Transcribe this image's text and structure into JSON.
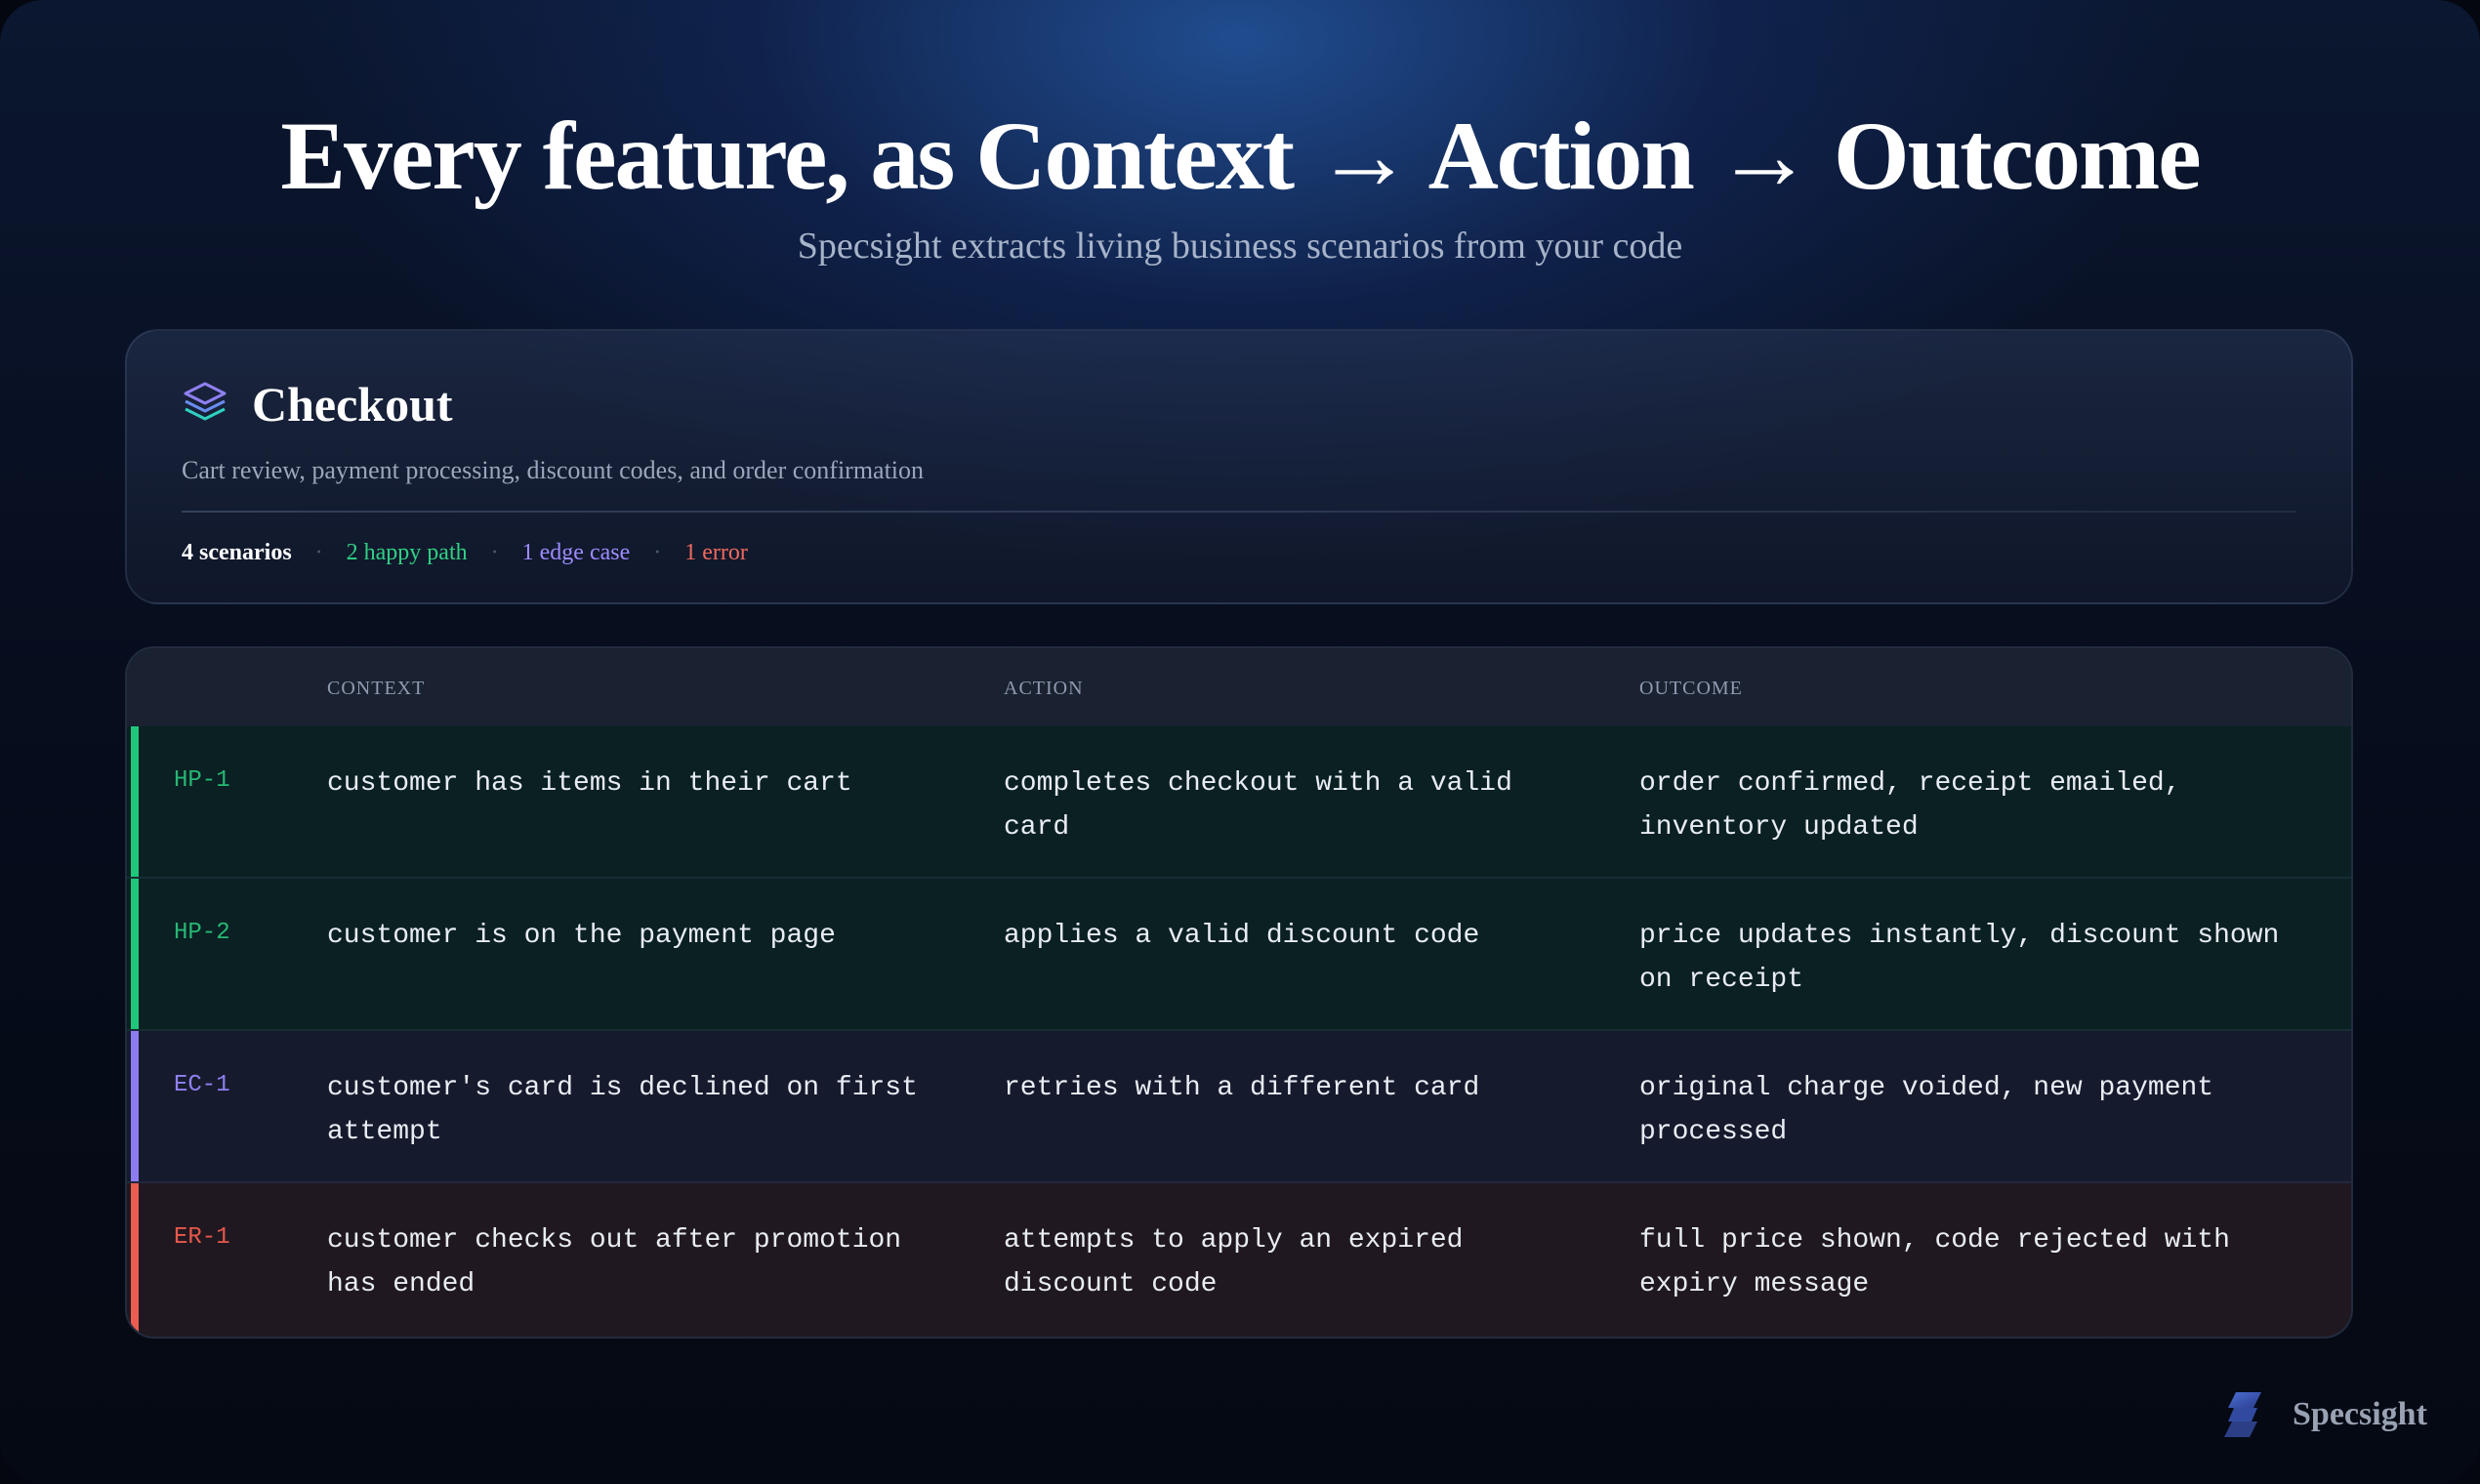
{
  "hero": {
    "title": "Every feature, as Context → Action → Outcome",
    "subtitle": "Specsight extracts living business scenarios from your code"
  },
  "feature": {
    "icon": "layers-icon",
    "title": "Checkout",
    "description": "Cart review, payment processing, discount codes, and order confirmation",
    "stats": {
      "total": "4 scenarios",
      "happy": "2 happy path",
      "edge": "1 edge case",
      "error": "1 error",
      "separator": "·"
    }
  },
  "table": {
    "headers": {
      "context": "CONTEXT",
      "action": "ACTION",
      "outcome": "OUTCOME"
    },
    "rows": [
      {
        "id": "HP-1",
        "kind": "happy",
        "context": "customer has items in their cart",
        "action": "completes checkout with a valid card",
        "outcome": "order confirmed, receipt emailed, inventory updated"
      },
      {
        "id": "HP-2",
        "kind": "happy",
        "context": "customer is on the payment page",
        "action": "applies a valid discount code",
        "outcome": "price updates instantly, discount shown on receipt"
      },
      {
        "id": "EC-1",
        "kind": "edge",
        "context": "customer's card is declined on first attempt",
        "action": "retries with a different card",
        "outcome": "original charge voided, new payment processed"
      },
      {
        "id": "ER-1",
        "kind": "error",
        "context": "customer checks out after promotion has ended",
        "action": "attempts to apply an expired discount code",
        "outcome": "full price shown, code rejected with expiry message"
      }
    ]
  },
  "brand": {
    "name": "Specsight",
    "icon": "specsight-logo-icon"
  },
  "colors": {
    "happy": "#20c77a",
    "edge": "#8d7cf0",
    "error": "#ea5d50"
  }
}
